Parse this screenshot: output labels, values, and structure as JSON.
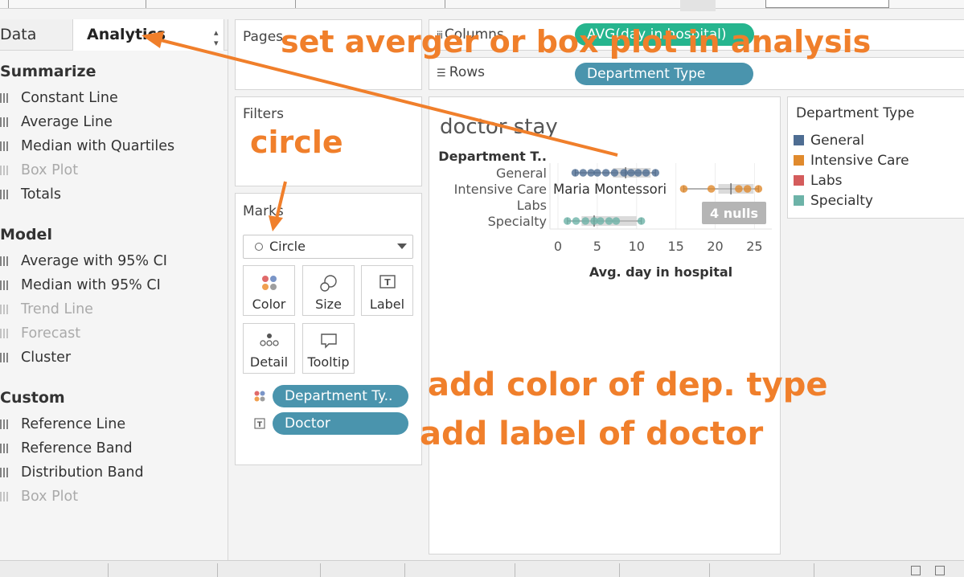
{
  "left_pane": {
    "tabs": {
      "data": "Data",
      "analytics": "Analytics"
    },
    "sections": [
      {
        "title": "Summarize",
        "items": [
          {
            "label": "Constant Line",
            "enabled": true
          },
          {
            "label": "Average Line",
            "enabled": true
          },
          {
            "label": "Median with Quartiles",
            "enabled": true
          },
          {
            "label": "Box Plot",
            "enabled": false
          },
          {
            "label": "Totals",
            "enabled": true
          }
        ]
      },
      {
        "title": "Model",
        "items": [
          {
            "label": "Average with 95% CI",
            "enabled": true
          },
          {
            "label": "Median with 95% CI",
            "enabled": true
          },
          {
            "label": "Trend Line",
            "enabled": false
          },
          {
            "label": "Forecast",
            "enabled": false
          },
          {
            "label": "Cluster",
            "enabled": true
          }
        ]
      },
      {
        "title": "Custom",
        "items": [
          {
            "label": "Reference Line",
            "enabled": true
          },
          {
            "label": "Reference Band",
            "enabled": true
          },
          {
            "label": "Distribution Band",
            "enabled": true
          },
          {
            "label": "Box Plot",
            "enabled": false
          }
        ]
      }
    ]
  },
  "shelves": {
    "pages": "Pages",
    "filters": "Filters",
    "marks": "Marks",
    "mark_type": "Circle",
    "buttons": {
      "color": "Color",
      "size": "Size",
      "label": "Label",
      "detail": "Detail",
      "tooltip": "Tooltip"
    },
    "mark_pills": [
      "Department Ty..",
      "Doctor"
    ],
    "columns": "Columns",
    "columns_pill": "AVG(day in hospital)",
    "rows": "Rows",
    "rows_pill": "Department Type"
  },
  "view": {
    "title": "doctor stay",
    "row_header": "Department T..",
    "point_label": "Maria Montessori",
    "nulls_badge": "4 nulls"
  },
  "chart_data": {
    "type": "scatter",
    "title": "doctor stay",
    "xlabel": "Avg. day in hospital",
    "ylabel": "Department T..",
    "xlim": [
      0,
      27
    ],
    "xticks": [
      0,
      5,
      10,
      15,
      20,
      25
    ],
    "categories": [
      "General",
      "Intensive Care",
      "Labs",
      "Specialty"
    ],
    "series": [
      {
        "name": "General",
        "color": "#4e6d92",
        "values": [
          2.2,
          3.2,
          4.2,
          5.0,
          6.1,
          7.2,
          8.4,
          9.3,
          10.2,
          11.2,
          12.4
        ]
      },
      {
        "name": "Intensive Care",
        "color": "#e08a2d",
        "values": [
          16.0,
          19.5,
          23.0,
          24.1,
          25.5
        ]
      },
      {
        "name": "Labs",
        "color": "#d45c5c",
        "values": []
      },
      {
        "name": "Specialty",
        "color": "#6db3a8",
        "values": [
          1.2,
          2.3,
          3.5,
          4.6,
          5.4,
          6.5,
          7.4,
          10.6
        ]
      }
    ],
    "reference": [
      {
        "category": "General",
        "min": 2.2,
        "max": 12.4,
        "mid": 8.6
      },
      {
        "category": "Intensive Care",
        "min": 16.0,
        "max": 25.5,
        "mid": 22.0
      },
      {
        "category": "Specialty",
        "min": 1.2,
        "max": 10.6,
        "mid": 4.6
      }
    ],
    "legend": {
      "title": "Department Type",
      "items": [
        {
          "label": "General",
          "color": "#4e6d92"
        },
        {
          "label": "Intensive Care",
          "color": "#e08a2d"
        },
        {
          "label": "Labs",
          "color": "#d45c5c"
        },
        {
          "label": "Specialty",
          "color": "#6db3a8"
        }
      ],
      "placement": "right"
    }
  },
  "annotations": {
    "top": "set averger or box plot in analysis",
    "circle": "circle",
    "color": "add color of dep. type",
    "label": "add label of doctor",
    "color_hex": "#f07f2b"
  }
}
